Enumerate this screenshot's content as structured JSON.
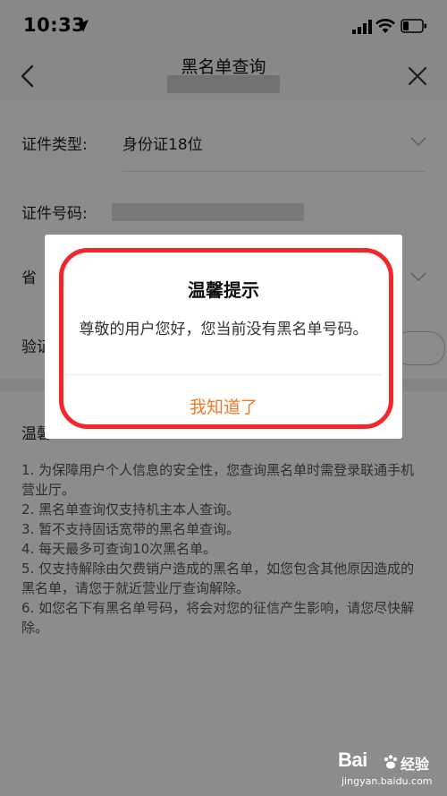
{
  "status_bar": {
    "time": "10:33"
  },
  "nav": {
    "title": "黑名单查询"
  },
  "form": {
    "id_type_label": "证件类型:",
    "id_type_value": "身份证18位",
    "id_number_label": "证件号码:",
    "province_label": "省",
    "captcha_label": "验证"
  },
  "tips": {
    "heading": "温馨",
    "items": [
      "1. 为保障用户个人信息的安全性，您查询黑名单时需登录联通手机营业厅。",
      "2. 黑名单查询仅支持机主本人查询。",
      "3. 暂不支持固话宽带的黑名单查询。",
      "4. 每天最多可查询10次黑名单。",
      "5. 仅支持解除由欠费销户造成的黑名单，如您包含其他原因造成的黑名单，请您于就近营业厅查询解除。",
      "6. 如您名下有黑名单号码，将会对您的征信产生影响，请您尽快解除。"
    ]
  },
  "dialog": {
    "title": "温馨提示",
    "message": "尊敬的用户您好，您当前没有黑名单号码。",
    "button_label": "我知道了"
  },
  "watermark": {
    "logo": "Bai",
    "text": "经验",
    "url": "jingyan.baidu.com"
  },
  "colors": {
    "accent": "#f07a23",
    "highlight": "#f0282d",
    "overlay": "rgba(0,0,0,0.45)"
  }
}
